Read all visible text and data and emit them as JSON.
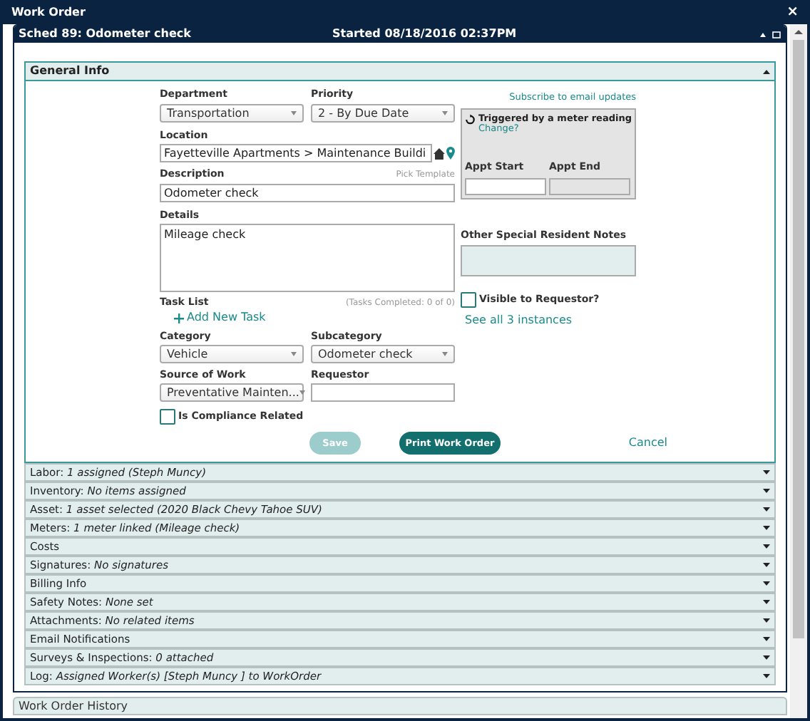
{
  "window": {
    "title": "Work Order",
    "close": "×"
  },
  "panel": {
    "title": "Sched 89: Odometer check",
    "started": "Started 08/18/2016 02:37PM"
  },
  "general": {
    "title": "General Info",
    "expanded": true,
    "department": {
      "label": "Department",
      "value": "Transportation"
    },
    "priority": {
      "label": "Priority",
      "value": "2 - By Due Date"
    },
    "subscribe": "Subscribe to email updates",
    "trigger": {
      "text": "Triggered by a meter reading",
      "link": "Change?"
    },
    "appt_start": {
      "label": "Appt Start",
      "disabled": false
    },
    "appt_end": {
      "label": "Appt End",
      "disabled": true
    },
    "location": {
      "label": "Location",
      "value": "Fayetteville Apartments > Maintenance Buildi"
    },
    "description": {
      "label": "Description",
      "value": "Odometer check",
      "link": "Pick Template"
    },
    "details": {
      "label": "Details",
      "value": "Mileage check"
    },
    "notes": {
      "label": "Other Special Resident Notes"
    },
    "task_list": {
      "label": "Task List",
      "completed": "(Tasks Completed: 0 of 0)",
      "add": "Add New Task"
    },
    "visible": {
      "label": "Visible to Requestor?",
      "checked": false
    },
    "instances": "See all 3 instances",
    "category": {
      "label": "Category",
      "value": "Vehicle"
    },
    "subcategory": {
      "label": "Subcategory",
      "value": "Odometer check"
    },
    "source": {
      "label": "Source of Work",
      "value": "Preventative Mainten..."
    },
    "requestor": {
      "label": "Requestor"
    },
    "compliance": {
      "label": "Is Compliance Related",
      "checked": false
    },
    "buttons": {
      "save": {
        "label": "Save",
        "disabled": true
      },
      "print": "Print Work Order",
      "cancel": "Cancel"
    }
  },
  "sections": [
    {
      "text": "Labor: *1 assigned (Steph Muncy)*",
      "expanded": false
    },
    {
      "text": "Inventory: *No items assigned*",
      "expanded": false
    },
    {
      "text": "Asset: *1 asset selected (2020 Black Chevy Tahoe SUV)*",
      "expanded": false
    },
    {
      "text": "Meters: *1 meter linked (Mileage check)*",
      "expanded": false
    },
    {
      "text": "Costs",
      "expanded": false
    },
    {
      "text": "Signatures: *No signatures*",
      "expanded": false
    },
    {
      "text": "Billing Info",
      "expanded": false
    },
    {
      "text": "Safety Notes: *None set*",
      "expanded": false
    },
    {
      "text": "Attachments: *No related items*",
      "expanded": false
    },
    {
      "text": "Email Notifications",
      "expanded": false
    },
    {
      "text": "Surveys & Inspections: *0 attached*",
      "expanded": false
    },
    {
      "text": "Log: *Assigned Worker(s) [Steph Muncy ] to WorkOrder*",
      "expanded": false
    }
  ],
  "history": {
    "title": "Work Order History"
  }
}
